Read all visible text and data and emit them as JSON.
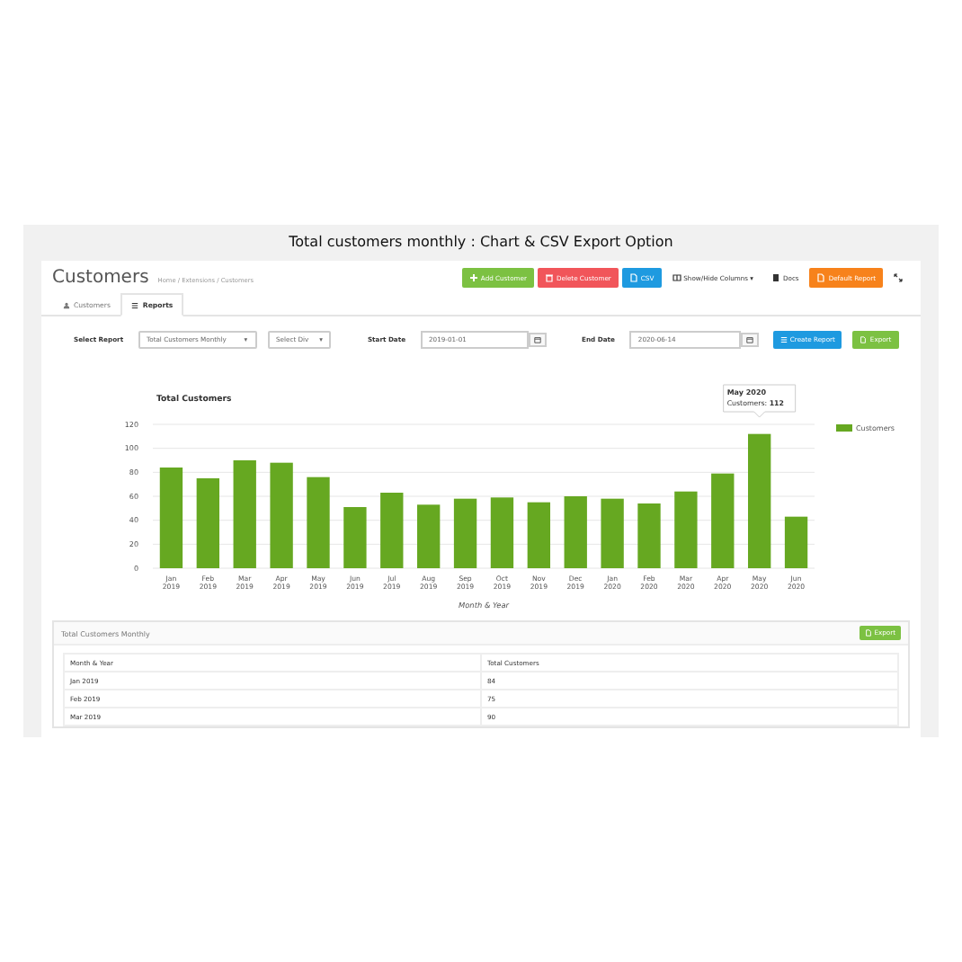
{
  "caption": "Total customers monthly : Chart & CSV Export Option",
  "page": {
    "title": "Customers",
    "breadcrumb": "Home / Extensions / Customers"
  },
  "actions": [
    {
      "label": "Add Customer",
      "kind": "add"
    },
    {
      "label": "Delete Customer",
      "kind": "delete"
    },
    {
      "label": "CSV",
      "kind": "csv"
    },
    {
      "label": "Show/Hide Columns ▾",
      "kind": "columns"
    },
    {
      "label": "Docs",
      "kind": "docs"
    },
    {
      "label": "Default Report",
      "kind": "report"
    },
    {
      "kind": "fullscreen"
    }
  ],
  "tabs": [
    {
      "label": "Customers",
      "selected": false
    },
    {
      "label": "Reports",
      "selected": true
    }
  ],
  "filters": {
    "report_label": "Select Report",
    "report_select": {
      "value": "Total Customers Monthly",
      "caret": "▾"
    },
    "division_select": {
      "value": "Select Div",
      "caret": "▾"
    },
    "start_label": "Start Date",
    "start_value": "2019-01-01",
    "end_label": "End Date",
    "end_value": "2020-06-14",
    "create_button": "Create Report",
    "export_button": "Export"
  },
  "chart": {
    "chart_data": {
      "type": "bar",
      "title": "Total Customers",
      "xlabel": "Month & Year",
      "categories": [
        "Jan 2019",
        "Feb 2019",
        "Mar 2019",
        "Apr 2019",
        "May 2019",
        "Jun 2019",
        "Jul 2019",
        "Aug 2019",
        "Sep 2019",
        "Oct 2019",
        "Nov 2019",
        "Dec 2019",
        "Jan 2020",
        "Feb 2020",
        "Mar 2020",
        "Apr 2020",
        "May 2020",
        "Jun 2020"
      ],
      "series": [
        {
          "name": "Customers",
          "color": "#66a821",
          "values": [
            84,
            75,
            90,
            88,
            76,
            51,
            63,
            53,
            58,
            59,
            55,
            60,
            58,
            54,
            64,
            79,
            112,
            43
          ]
        }
      ],
      "grid": true,
      "ylim": [
        0,
        120
      ],
      "yticks": [
        0,
        20,
        40,
        60,
        80,
        100,
        120
      ]
    },
    "tooltip": {
      "title": "May 2020",
      "label": "Customers:",
      "value": "112"
    }
  },
  "table": {
    "title": "Total Customers Monthly",
    "export_button": "Export",
    "columns": [
      "Month & Year",
      "Total Customers"
    ],
    "rows": [
      [
        "Jan 2019",
        "84"
      ],
      [
        "Feb 2019",
        "75"
      ],
      [
        "Mar 2019",
        "90"
      ]
    ]
  }
}
